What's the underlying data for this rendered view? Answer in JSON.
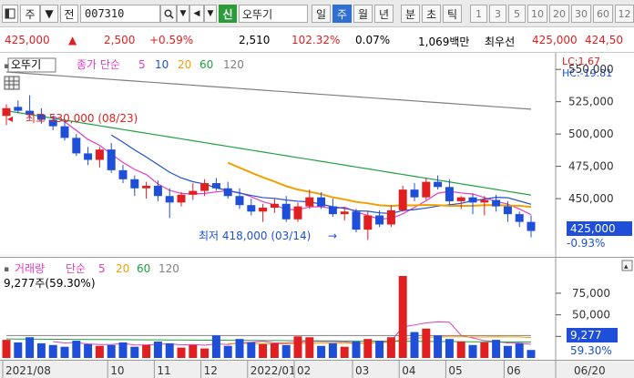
{
  "toolbar": {
    "market": "주",
    "period": "전",
    "code": "007310",
    "new_badge": "신",
    "stock_name": "오뚜기",
    "period_tabs": [
      "일",
      "주",
      "월",
      "년",
      "분",
      "초",
      "틱"
    ],
    "active_tab": "주",
    "numbers": [
      "1",
      "3",
      "5",
      "10",
      "20",
      "30",
      "60",
      "12"
    ]
  },
  "quote": {
    "price": "425,000",
    "arrow": "▲",
    "change": "2,500",
    "change_pct": "+0.59%",
    "volume": "2,510",
    "volume_ratio": "102.32%",
    "turnover": "0.07%",
    "amount": "1,069백만",
    "tag": "최우선",
    "ask": "425,000",
    "bid": "424,50"
  },
  "price_panel": {
    "stock_label": "오뚜기",
    "ma_label": "종가 단순",
    "ma_periods": [
      "5",
      "10",
      "20",
      "60",
      "120"
    ],
    "lc": "LC:1.67",
    "hc": "HC:-19.81",
    "ticks": [
      "550,000",
      "525,000",
      "500,000",
      "475,000",
      "450,000"
    ],
    "high_note": "최고 530,000 (08/23)",
    "low_note": "최저 418,000 (03/14)",
    "current_price": "425,000",
    "current_pct": "-0.93%"
  },
  "volume_panel": {
    "label": "거래량",
    "ma_label": "단순",
    "ma_periods": [
      "5",
      "20",
      "60",
      "120"
    ],
    "current": "9,277주(59.30%)",
    "ticks": [
      "75,000",
      "50,000",
      "25,000"
    ],
    "current_value": "9,277",
    "current_pct": "59.30%"
  },
  "xaxis": {
    "labels": [
      "2021/08",
      "10",
      "11",
      "12",
      "2022/01",
      "02",
      "03",
      "04",
      "05",
      "06"
    ],
    "date_box": "06/20"
  },
  "colors": {
    "up": "#e02020",
    "down": "#1f4fd8",
    "ma5": "#e040c0",
    "ma10": "#2050d0",
    "ma20": "#f0a000",
    "ma60": "#20a040",
    "ma120": "#808080"
  },
  "chart_data": {
    "type": "candlestick",
    "x": [
      "2021-08-09",
      "2021-08-16",
      "2021-08-23",
      "2021-08-30",
      "2021-09-06",
      "2021-09-13",
      "2021-09-20",
      "2021-09-27",
      "2021-10-04",
      "2021-10-11",
      "2021-10-18",
      "2021-10-25",
      "2021-11-01",
      "2021-11-08",
      "2021-11-15",
      "2021-11-22",
      "2021-11-29",
      "2021-12-06",
      "2021-12-13",
      "2021-12-20",
      "2021-12-27",
      "2022-01-03",
      "2022-01-10",
      "2022-01-17",
      "2022-01-24",
      "2022-01-31",
      "2022-02-07",
      "2022-02-14",
      "2022-02-21",
      "2022-02-28",
      "2022-03-07",
      "2022-03-14",
      "2022-03-21",
      "2022-03-28",
      "2022-04-04",
      "2022-04-11",
      "2022-04-18",
      "2022-04-25",
      "2022-05-02",
      "2022-05-09",
      "2022-05-16",
      "2022-05-23",
      "2022-05-30",
      "2022-06-06",
      "2022-06-13",
      "2022-06-20"
    ],
    "ohlc": [
      [
        514000,
        523000,
        507000,
        520000
      ],
      [
        521000,
        526000,
        516000,
        518000
      ],
      [
        518000,
        530000,
        512000,
        515000
      ],
      [
        515000,
        520000,
        508000,
        511000
      ],
      [
        511000,
        514000,
        503000,
        506000
      ],
      [
        506000,
        510000,
        495000,
        497000
      ],
      [
        497000,
        500000,
        483000,
        485000
      ],
      [
        485000,
        490000,
        476000,
        480000
      ],
      [
        480000,
        490000,
        474000,
        488000
      ],
      [
        488000,
        493000,
        470000,
        472000
      ],
      [
        472000,
        476000,
        462000,
        465000
      ],
      [
        465000,
        468000,
        452000,
        458000
      ],
      [
        458000,
        463000,
        450000,
        460000
      ],
      [
        460000,
        464000,
        448000,
        452000
      ],
      [
        452000,
        458000,
        435000,
        447000
      ],
      [
        447000,
        455000,
        444000,
        453000
      ],
      [
        453000,
        462000,
        449000,
        456000
      ],
      [
        456000,
        465000,
        452000,
        462000
      ],
      [
        462000,
        466000,
        456000,
        458000
      ],
      [
        458000,
        463000,
        450000,
        452000
      ],
      [
        452000,
        458000,
        442000,
        445000
      ],
      [
        445000,
        450000,
        437000,
        440000
      ],
      [
        440000,
        446000,
        432000,
        443000
      ],
      [
        443000,
        450000,
        439000,
        446000
      ],
      [
        446000,
        452000,
        432000,
        434000
      ],
      [
        434000,
        447000,
        432000,
        444000
      ],
      [
        444000,
        457000,
        442000,
        451000
      ],
      [
        451000,
        455000,
        442000,
        444000
      ],
      [
        444000,
        450000,
        436000,
        438000
      ],
      [
        438000,
        443000,
        433000,
        440000
      ],
      [
        440000,
        442000,
        424000,
        426000
      ],
      [
        426000,
        440000,
        418000,
        437000
      ],
      [
        437000,
        441000,
        428000,
        430000
      ],
      [
        430000,
        445000,
        428000,
        441000
      ],
      [
        441000,
        460000,
        440000,
        457000
      ],
      [
        457000,
        462000,
        448000,
        451000
      ],
      [
        451000,
        466000,
        449000,
        463000
      ],
      [
        463000,
        468000,
        457000,
        459000
      ],
      [
        459000,
        465000,
        445000,
        448000
      ],
      [
        448000,
        452000,
        442000,
        451000
      ],
      [
        451000,
        454000,
        438000,
        447000
      ],
      [
        447000,
        452000,
        437000,
        449000
      ],
      [
        449000,
        453000,
        440000,
        444000
      ],
      [
        444000,
        448000,
        432000,
        438000
      ],
      [
        438000,
        440000,
        428000,
        432000
      ],
      [
        432000,
        437000,
        420000,
        425000
      ]
    ],
    "volume": [
      21000,
      18000,
      24000,
      17000,
      15000,
      13000,
      20000,
      16000,
      14000,
      15000,
      18000,
      13000,
      15000,
      19000,
      17000,
      12000,
      15000,
      11000,
      26000,
      14000,
      22000,
      18000,
      16000,
      17000,
      15000,
      25000,
      24000,
      14000,
      17000,
      13000,
      19000,
      22000,
      20000,
      24000,
      95000,
      30000,
      34000,
      26000,
      22000,
      19000,
      15000,
      18000,
      21000,
      14000,
      17000,
      9277
    ],
    "ylim": [
      412000,
      560000
    ],
    "volume_ylim": [
      0,
      95000
    ]
  }
}
